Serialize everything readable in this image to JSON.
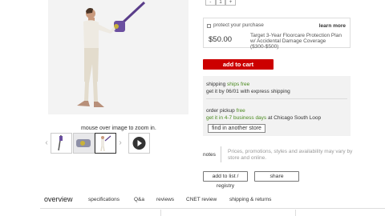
{
  "product": {
    "zoom_hint": "mouse over image to zoom in.",
    "thumbnails": [
      "vacuum-image-icon",
      "vacuum-head-image-icon",
      "vacuum-woman-image-icon",
      "play-video-icon"
    ]
  },
  "quantity": {
    "minus": "-",
    "value": "1",
    "plus": "+"
  },
  "protection": {
    "title": "protect your purchase",
    "learn_more": "learn more",
    "price": "$50.00",
    "description": "Target 3-Year Floorcare Protection Plan w/ Accidental Damage Coverage ($300-$500)"
  },
  "cart": {
    "add_to_cart": "add to cart"
  },
  "shipping": {
    "label": "shipping",
    "status": "ships free",
    "estimate": "get it by 06/01 with express shipping",
    "pickup_label": "order pickup",
    "pickup_status": "free",
    "pickup_prefix": "get it in",
    "pickup_time": "4-7 business days",
    "pickup_suffix": "at Chicago South Loop",
    "find_store": "find in another store"
  },
  "notes": {
    "label": "notes",
    "text": "Prices, promotions, styles and availability may vary by store and online."
  },
  "actions": {
    "add_to_list": "add to list / registry",
    "share": "share"
  },
  "tabs": [
    {
      "label": "overview"
    },
    {
      "label": "specifications"
    },
    {
      "label": "Q&a"
    },
    {
      "label": "reviews"
    },
    {
      "label": "CNET review"
    },
    {
      "label": "shipping & returns"
    }
  ],
  "colors": {
    "accent_red": "#cc0000",
    "free_green": "#4a8a1f"
  }
}
